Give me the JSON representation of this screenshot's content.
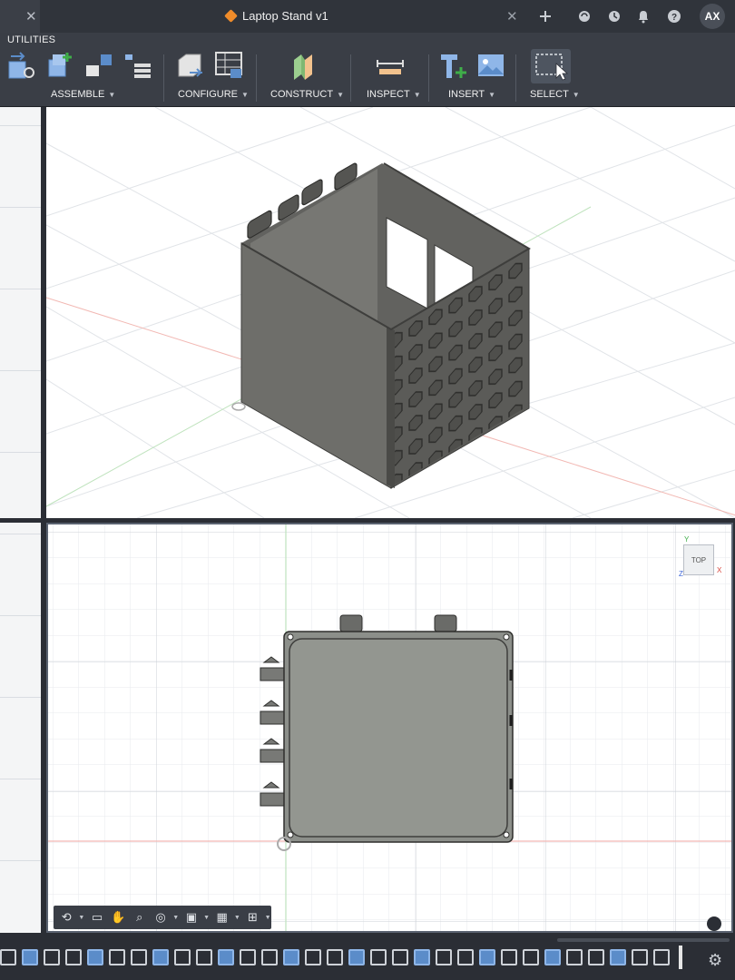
{
  "window": {
    "title": "Laptop Stand v1",
    "tab_close": "✕",
    "doc_close": "✕"
  },
  "titlebar_icons": [
    "plus-icon",
    "extensions-icon",
    "history-icon",
    "notifications-icon",
    "help-icon"
  ],
  "user": {
    "initials": "AX"
  },
  "ribbon": {
    "tab": "UTILITIES",
    "groups": [
      {
        "label": "ASSEMBLE"
      },
      {
        "label": "CONFIGURE"
      },
      {
        "label": "CONSTRUCT"
      },
      {
        "label": "INSPECT"
      },
      {
        "label": "INSERT"
      },
      {
        "label": "SELECT"
      }
    ]
  },
  "viewcube": {
    "face": "TOP",
    "x": "X",
    "y": "Y",
    "z": "Z"
  },
  "colors": {
    "model": "#5a5a57",
    "model_light": "#8e918c",
    "grid": "#dde1e6",
    "accent": "#5b8cc9"
  }
}
